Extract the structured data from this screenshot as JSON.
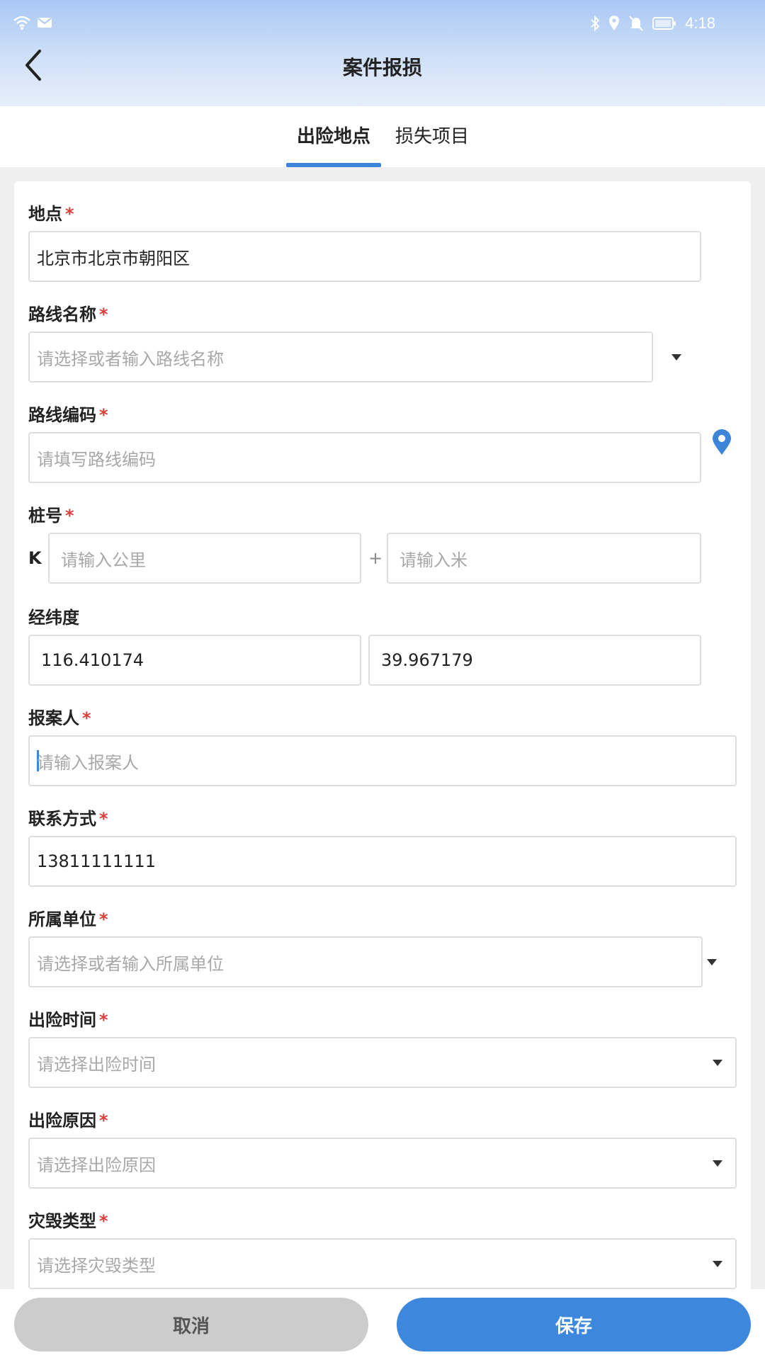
{
  "status_bar": {
    "time": "4:18",
    "left_icons": [
      "wifi-icon",
      "mail-icon"
    ],
    "right_icons": [
      "bluetooth-icon",
      "location-icon",
      "mute-icon",
      "battery-icon"
    ]
  },
  "header": {
    "title": "案件报损"
  },
  "tabs": [
    {
      "label": "出险地点",
      "active": true
    },
    {
      "label": "损失项目",
      "active": false
    }
  ],
  "form": {
    "location": {
      "label": "地点",
      "value": "北京市北京市朝阳区"
    },
    "route_name": {
      "label": "路线名称",
      "placeholder": "请选择或者输入路线名称"
    },
    "route_code": {
      "label": "路线编码",
      "placeholder": "请填写路线编码"
    },
    "stake": {
      "label": "桩号",
      "prefix": "K",
      "km_placeholder": "请输入公里",
      "separator": "+",
      "m_placeholder": "请输入米"
    },
    "coords": {
      "label": "经纬度",
      "longitude": "116.410174",
      "latitude": "39.967179"
    },
    "reporter": {
      "label": "报案人",
      "placeholder": "请输入报案人"
    },
    "contact": {
      "label": "联系方式",
      "value": "13811111111"
    },
    "unit": {
      "label": "所属单位",
      "placeholder": "请选择或者输入所属单位"
    },
    "time": {
      "label": "出险时间",
      "placeholder": "请选择出险时间"
    },
    "cause": {
      "label": "出险原因",
      "placeholder": "请选择出险原因"
    },
    "damage_type": {
      "label": "灾毁类型",
      "placeholder": "请选择灾毁类型"
    },
    "required_mark": "*"
  },
  "footer": {
    "cancel_label": "取消",
    "save_label": "保存"
  },
  "colors": {
    "accent": "#3d87dd",
    "required": "#d9403a",
    "cancel_bg": "#cccccc"
  }
}
